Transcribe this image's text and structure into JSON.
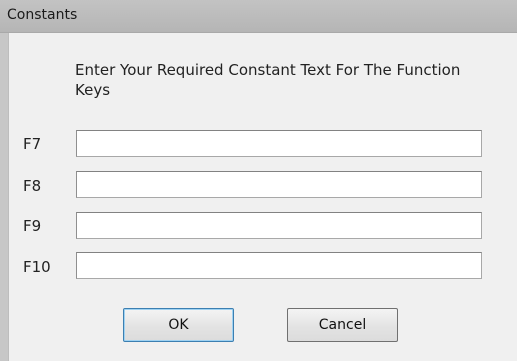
{
  "window": {
    "title": "Constants"
  },
  "instruction": "Enter Your Required Constant Text For The Function Keys",
  "fields": [
    {
      "label": "F7",
      "value": ""
    },
    {
      "label": "F8",
      "value": ""
    },
    {
      "label": "F9",
      "value": ""
    },
    {
      "label": "F10",
      "value": ""
    }
  ],
  "buttons": {
    "ok_label": "OK",
    "cancel_label": "Cancel"
  }
}
